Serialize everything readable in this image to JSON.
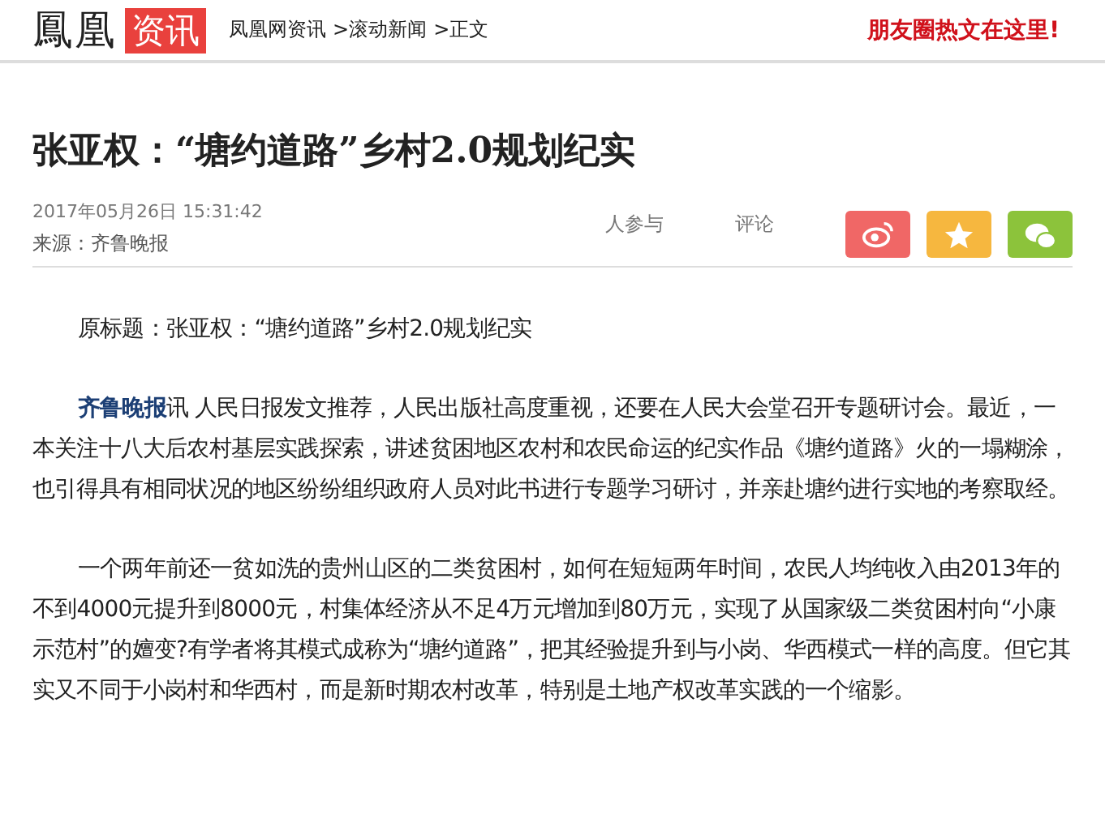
{
  "header": {
    "logo": "鳳凰",
    "logo_badge": "资讯",
    "breadcrumbs": [
      "凤凰网资讯",
      ">滚动新闻",
      ">正文"
    ],
    "promo": "朋友圈热文在这里!"
  },
  "article": {
    "title": "张亚权：“塘约道路”乡村2.0规划纪实",
    "datetime": "2017年05月26日 15:31:42",
    "source": "来源：齐鲁晚报",
    "participants": "人参与",
    "comments": "评论",
    "share": [
      {
        "kind": "weibo"
      },
      {
        "kind": "favorite"
      },
      {
        "kind": "wechat"
      }
    ],
    "paragraphs": [
      {
        "text": "原标题：张亚权：“塘约道路”乡村2.0规划纪实"
      },
      {
        "lead": "齐鲁晚报",
        "text": "讯  人民日报发文推荐，人民出版社高度重视，还要在人民大会堂召开专题研讨会。最近，一本关注十八大后农村基层实践探索，讲述贫困地区农村和农民命运的纪实作品《塘约道路》火的一塌糊涂，也引得具有相同状况的地区纷纷组织政府人员对此书进行专题学习研讨，并亲赴塘约进行实地的考察取经。"
      },
      {
        "text": "一个两年前还一贫如洗的贵州山区的二类贫困村，如何在短短两年时间，农民人均纯收入由2013年的不到4000元提升到8000元，村集体经济从不足4万元增加到80万元，实现了从国家级二类贫困村向“小康示范村”的嬗变?有学者将其模式成称为“塘约道路”，把其经验提升到与小岗、华西模式一样的高度。但它其实又不同于小岗村和华西村，而是新时期农村改革，特别是土地产权改革实践的一个缩影。"
      }
    ]
  }
}
